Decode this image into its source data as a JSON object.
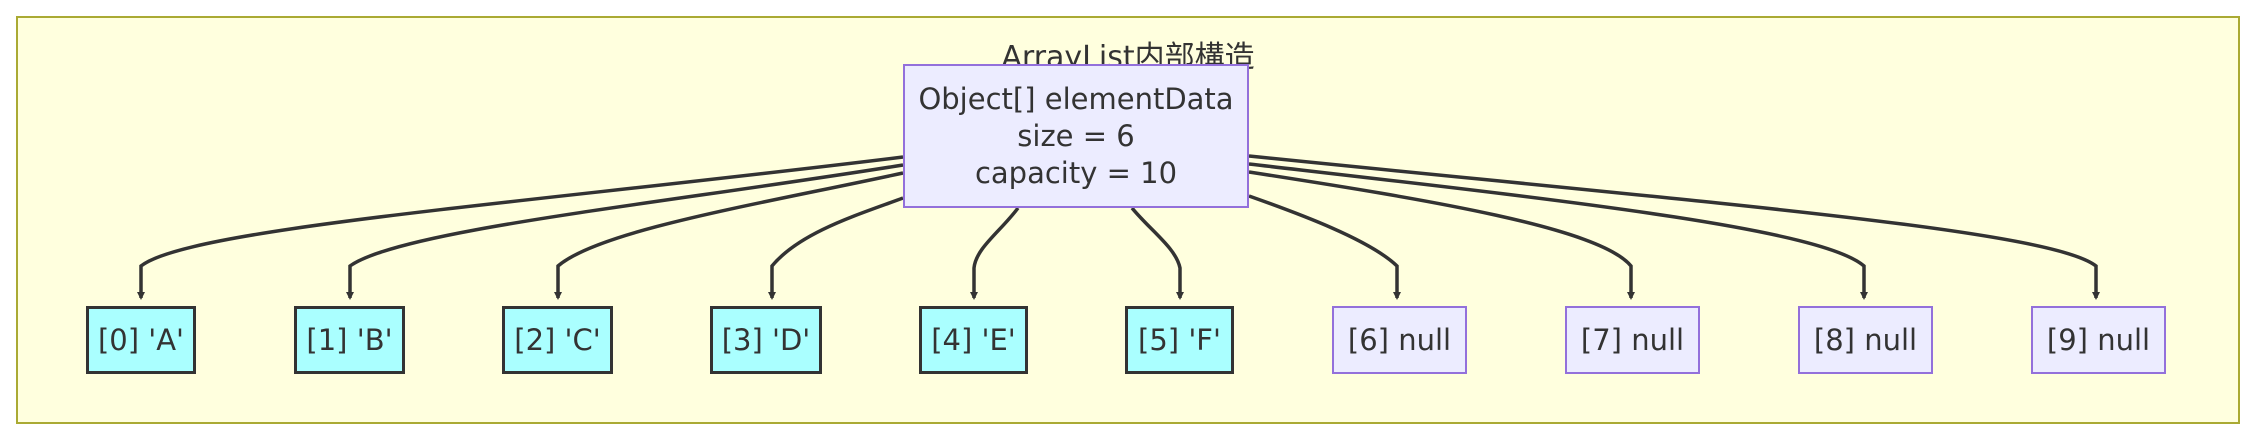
{
  "subgraph": {
    "title": "ArrayList内部構造"
  },
  "root": {
    "line1": "Object[] elementData",
    "line2": "size = 6",
    "line3": "capacity = 10"
  },
  "elements": [
    {
      "label": "[0] 'A'",
      "state": "filled"
    },
    {
      "label": "[1] 'B'",
      "state": "filled"
    },
    {
      "label": "[2] 'C'",
      "state": "filled"
    },
    {
      "label": "[3] 'D'",
      "state": "filled"
    },
    {
      "label": "[4] 'E'",
      "state": "filled"
    },
    {
      "label": "[5] 'F'",
      "state": "filled"
    },
    {
      "label": "[6] null",
      "state": "null"
    },
    {
      "label": "[7] null",
      "state": "null"
    },
    {
      "label": "[8] null",
      "state": "null"
    },
    {
      "label": "[9] null",
      "state": "null"
    }
  ],
  "colors": {
    "subgraph_fill": "#ffffde",
    "subgraph_border": "#aaaa33",
    "node_fill": "#ececff",
    "node_border": "#9370db",
    "filled_fill": "#aaffff",
    "filled_border": "#333333",
    "edge": "#333333",
    "text": "#333333"
  }
}
